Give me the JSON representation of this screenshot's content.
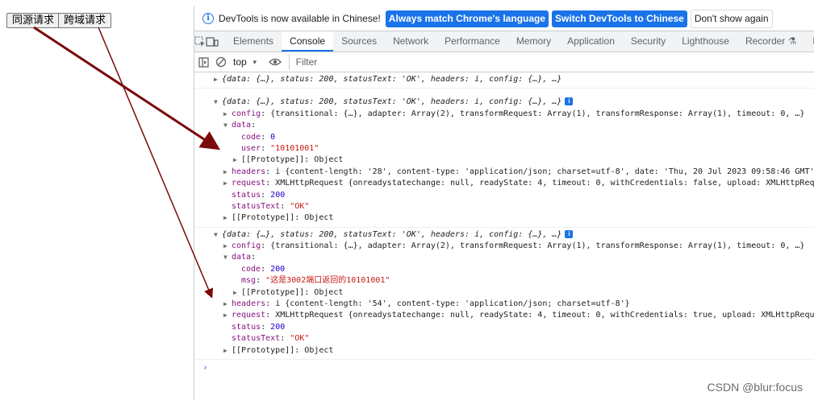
{
  "page": {
    "buttons": [
      {
        "label": "同源请求"
      },
      {
        "label": "跨域请求"
      }
    ]
  },
  "devtools": {
    "notice": {
      "text": "DevTools is now available in Chinese!",
      "btn_match": "Always match Chrome's language",
      "btn_switch": "Switch DevTools to Chinese",
      "btn_dismiss": "Don't show again"
    },
    "tabs": [
      "Elements",
      "Console",
      "Sources",
      "Network",
      "Performance",
      "Memory",
      "Application",
      "Security",
      "Lighthouse",
      "Recorder",
      "Perf"
    ],
    "active_tab": "Console",
    "toolbar": {
      "context": "top",
      "filter_placeholder": "Filter"
    },
    "colors": {
      "accent": "#1a73e8",
      "arrow": "#7b0a0a"
    }
  },
  "console": {
    "collapsed_summary": "{data: {…}, status: 200, statusText: 'OK', headers: i, config: {…}, …}",
    "msg1": {
      "summary": "{data: {…}, status: 200, statusText: 'OK', headers: i, config: {…}, …}",
      "config": "{transitional: {…}, adapter: Array(2), transformRequest: Array(1), transformResponse: Array(1), timeout: 0, …}",
      "code": "0",
      "user": "\"10101001\"",
      "proto_obj": "[[Prototype]]: Object",
      "headers": "i {content-length: '28', content-type: 'application/json; charset=utf-8', date: 'Thu, 20 Jul 2023 09:58:46 GMT', …",
      "request": "XMLHttpRequest {onreadystatechange: null, readyState: 4, timeout: 0, withCredentials: false, upload: XMLHttpReque",
      "status": "200",
      "statusText": "\"OK\""
    },
    "msg2": {
      "summary": "{data: {…}, status: 200, statusText: 'OK', headers: i, config: {…}, …}",
      "config": "{transitional: {…}, adapter: Array(2), transformRequest: Array(1), transformResponse: Array(1), timeout: 0, …}",
      "code": "200",
      "msg": "\"这是3002端口返回的10101001\"",
      "proto_obj": "[[Prototype]]: Object",
      "headers": "i {content-length: '54', content-type: 'application/json; charset=utf-8'}",
      "request": "XMLHttpRequest {onreadystatechange: null, readyState: 4, timeout: 0, withCredentials: true, upload: XMLHttpReques",
      "status": "200",
      "statusText": "\"OK\""
    },
    "keys": {
      "config": "config",
      "data": "data",
      "code": "code",
      "user": "user",
      "msg": "msg",
      "headers": "headers",
      "request": "request",
      "status": "status",
      "statusText": "statusText"
    }
  },
  "watermark": "CSDN @blur:focus"
}
